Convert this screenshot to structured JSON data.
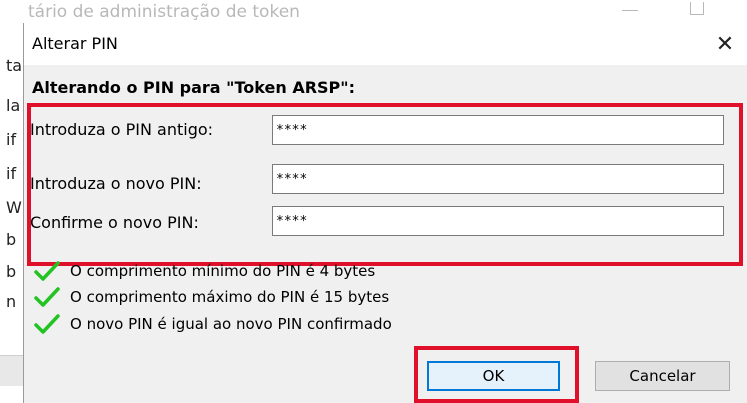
{
  "background_window": {
    "title": "tário de administração de token",
    "fragments": [
      "ta",
      "la",
      "if",
      "if",
      "W",
      "b",
      "b",
      "n"
    ]
  },
  "dialog": {
    "title": "Alterar PIN",
    "close_glyph": "✕",
    "heading": "Alterando o PIN para \"Token ARSP\":",
    "fields": [
      {
        "label": "Introduza o PIN antigo:",
        "value": "****"
      },
      {
        "label": "Introduza o novo PIN:",
        "value": "****"
      },
      {
        "label": "Confirme o novo PIN:",
        "value": "****"
      }
    ],
    "checks": [
      {
        "text": "O comprimento mínimo do PIN é 4 bytes",
        "icon": "check-icon"
      },
      {
        "text": "O comprimento máximo do PIN é 15 bytes",
        "icon": "check-icon"
      },
      {
        "text": "O novo PIN é igual ao novo PIN confirmado",
        "icon": "check-icon"
      }
    ],
    "buttons": {
      "ok": "OK",
      "cancel": "Cancelar"
    }
  },
  "colors": {
    "highlight": "#e0102a",
    "check": "#22c322",
    "focus": "#0078d7"
  }
}
